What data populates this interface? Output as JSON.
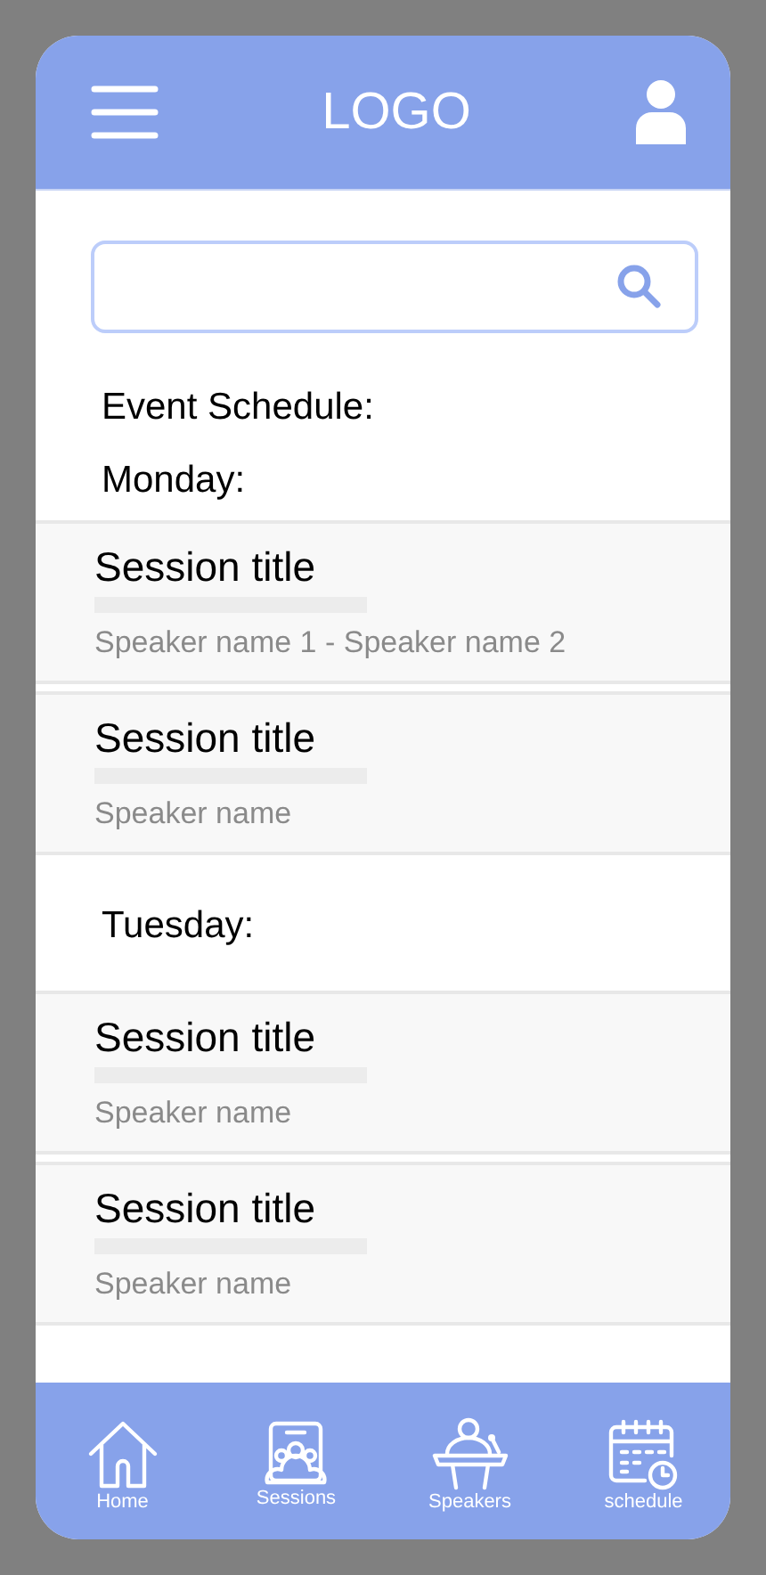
{
  "header": {
    "logo": "LOGO"
  },
  "title": "Event Schedule:",
  "days": [
    {
      "label": "Monday:",
      "sessions": [
        {
          "title": "Session title",
          "speakers": "Speaker name 1 - Speaker name 2"
        },
        {
          "title": "Session title",
          "speakers": "Speaker name"
        }
      ]
    },
    {
      "label": "Tuesday:",
      "sessions": [
        {
          "title": "Session title",
          "speakers": "Speaker name"
        },
        {
          "title": "Session title",
          "speakers": "Speaker name"
        }
      ]
    }
  ],
  "nav": [
    {
      "kind": "home",
      "label": "Home"
    },
    {
      "kind": "sessions",
      "label": "Sessions"
    },
    {
      "kind": "speakers",
      "label": "Speakers"
    },
    {
      "kind": "schedule",
      "label": "schedule"
    }
  ]
}
